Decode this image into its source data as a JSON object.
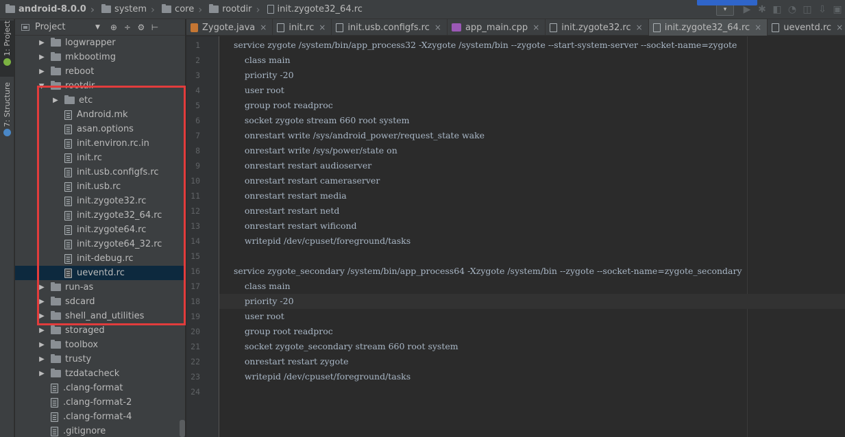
{
  "navbar": {
    "crumbs": [
      {
        "label": "android-8.0.0",
        "kind": "project"
      },
      {
        "label": "system",
        "kind": "folder"
      },
      {
        "label": "core",
        "kind": "folder"
      },
      {
        "label": "rootdir",
        "kind": "folder"
      },
      {
        "label": "init.zygote32_64.rc",
        "kind": "file"
      }
    ],
    "run_config_glyph": "▾",
    "tool_icons": [
      "run-icon",
      "debug-icon",
      "coverage-icon",
      "profile-icon",
      "attach-icon",
      "sdk-manager-icon",
      "device-manager-icon"
    ]
  },
  "left_strip": {
    "project_label": "1: Project",
    "structure_label": "7: Structure",
    "project_icon_color": "#7cb342",
    "structure_icon_color": "#4a88c7"
  },
  "project_panel": {
    "title": "Project",
    "header_icons": [
      "⊕",
      "÷",
      "⚙",
      "⊢"
    ],
    "tree": [
      {
        "label": "logwrapper",
        "type": "folder",
        "expanded": false,
        "depth": 0
      },
      {
        "label": "mkbootimg",
        "type": "folder",
        "expanded": false,
        "depth": 0
      },
      {
        "label": "reboot",
        "type": "folder",
        "expanded": false,
        "depth": 0
      },
      {
        "label": "rootdir",
        "type": "folder",
        "expanded": true,
        "depth": 0
      },
      {
        "label": "etc",
        "type": "folder",
        "expanded": false,
        "depth": 1
      },
      {
        "label": "Android.mk",
        "type": "file",
        "depth": 1
      },
      {
        "label": "asan.options",
        "type": "file",
        "depth": 1
      },
      {
        "label": "init.environ.rc.in",
        "type": "file",
        "depth": 1
      },
      {
        "label": "init.rc",
        "type": "file",
        "depth": 1
      },
      {
        "label": "init.usb.configfs.rc",
        "type": "file",
        "depth": 1
      },
      {
        "label": "init.usb.rc",
        "type": "file",
        "depth": 1
      },
      {
        "label": "init.zygote32.rc",
        "type": "file",
        "depth": 1
      },
      {
        "label": "init.zygote32_64.rc",
        "type": "file",
        "depth": 1
      },
      {
        "label": "init.zygote64.rc",
        "type": "file",
        "depth": 1
      },
      {
        "label": "init.zygote64_32.rc",
        "type": "file",
        "depth": 1
      },
      {
        "label": "init-debug.rc",
        "type": "file",
        "depth": 1
      },
      {
        "label": "ueventd.rc",
        "type": "file",
        "depth": 1,
        "selected": true
      },
      {
        "label": "run-as",
        "type": "folder",
        "expanded": false,
        "depth": 0
      },
      {
        "label": "sdcard",
        "type": "folder",
        "expanded": false,
        "depth": 0
      },
      {
        "label": "shell_and_utilities",
        "type": "folder",
        "expanded": false,
        "depth": 0
      },
      {
        "label": "storaged",
        "type": "folder",
        "expanded": false,
        "depth": 0
      },
      {
        "label": "toolbox",
        "type": "folder",
        "expanded": false,
        "depth": 0
      },
      {
        "label": "trusty",
        "type": "folder",
        "expanded": false,
        "depth": 0
      },
      {
        "label": "tzdatacheck",
        "type": "folder",
        "expanded": false,
        "depth": 0
      },
      {
        "label": ".clang-format",
        "type": "file",
        "depth": 0
      },
      {
        "label": ".clang-format-2",
        "type": "file",
        "depth": 0
      },
      {
        "label": ".clang-format-4",
        "type": "file",
        "depth": 0
      },
      {
        "label": ".gitignore",
        "type": "file",
        "depth": 0
      }
    ],
    "highlight_color": "#e23c3c"
  },
  "editor_tabs": [
    {
      "label": "Zygote.java",
      "icon": "java",
      "active": false
    },
    {
      "label": "init.rc",
      "icon": "file",
      "active": false
    },
    {
      "label": "init.usb.configfs.rc",
      "icon": "file",
      "active": false
    },
    {
      "label": "app_main.cpp",
      "icon": "cpp",
      "active": false
    },
    {
      "label": "init.zygote32.rc",
      "icon": "file",
      "active": false
    },
    {
      "label": "init.zygote32_64.rc",
      "icon": "file",
      "active": true
    },
    {
      "label": "ueventd.rc",
      "icon": "file",
      "active": false
    }
  ],
  "editor": {
    "current_line": 18,
    "lines": [
      "service zygote /system/bin/app_process32 -Xzygote /system/bin --zygote --start-system-server --socket-name=zygote",
      "    class main",
      "    priority -20",
      "    user root",
      "    group root readproc",
      "    socket zygote stream 660 root system",
      "    onrestart write /sys/android_power/request_state wake",
      "    onrestart write /sys/power/state on",
      "    onrestart restart audioserver",
      "    onrestart restart cameraserver",
      "    onrestart restart media",
      "    onrestart restart netd",
      "    onrestart restart wificond",
      "    writepid /dev/cpuset/foreground/tasks",
      "",
      "service zygote_secondary /system/bin/app_process64 -Xzygote /system/bin --zygote --socket-name=zygote_secondary",
      "    class main",
      "    priority -20",
      "    user root",
      "    group root readproc",
      "    socket zygote_secondary stream 660 root system",
      "    onrestart restart zygote",
      "    writepid /dev/cpuset/foreground/tasks",
      ""
    ],
    "line_numbers": [
      "1",
      "2",
      "3",
      "4",
      "5",
      "6",
      "7",
      "8",
      "9",
      "10",
      "11",
      "12",
      "13",
      "14",
      "15",
      "16",
      "17",
      "18",
      "19",
      "20",
      "21",
      "22",
      "23",
      "24"
    ]
  }
}
